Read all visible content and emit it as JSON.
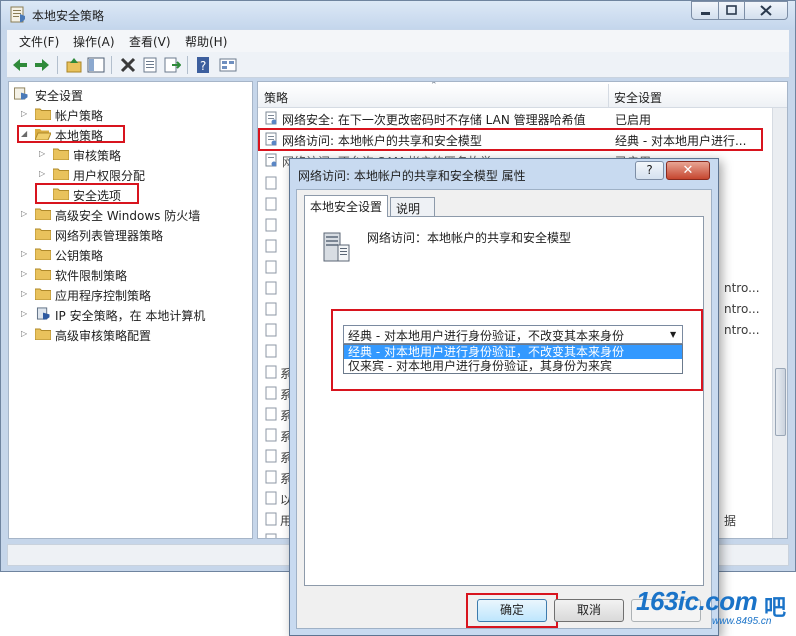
{
  "window": {
    "title": "本地安全策略"
  },
  "menu": [
    "文件(F)",
    "操作(A)",
    "查看(V)",
    "帮助(H)"
  ],
  "tree": {
    "root": "安全设置",
    "items": [
      {
        "label": "帐户策略"
      },
      {
        "label": "本地策略"
      },
      {
        "label": "审核策略"
      },
      {
        "label": "用户权限分配"
      },
      {
        "label": "安全选项"
      },
      {
        "label": "高级安全 Windows 防火墙"
      },
      {
        "label": "网络列表管理器策略"
      },
      {
        "label": "公钥策略"
      },
      {
        "label": "软件限制策略"
      },
      {
        "label": "应用程序控制策略"
      },
      {
        "label": "IP 安全策略，在 本地计算机"
      },
      {
        "label": "高级审核策略配置"
      }
    ]
  },
  "list": {
    "columns": [
      "策略",
      "安全设置"
    ],
    "rows": [
      {
        "policy": "网络安全: 在下一次更改密码时不存储 LAN 管理器哈希值",
        "setting": "已启用"
      },
      {
        "policy": "网络访问: 本地帐户的共享和安全模型",
        "setting": "经典 - 对本地用户进行..."
      },
      {
        "policy": "网络访问: 不允许 SAM 帐户的匿名枚举",
        "setting": "已启用"
      }
    ],
    "partial_right": [
      "ntro...",
      "ntro...",
      "ntro..."
    ],
    "partial_left": [
      "系",
      "系",
      "系",
      "系",
      "系",
      "系",
      "以",
      "用",
      "用"
    ],
    "partial_bottom_right": "据"
  },
  "dialog": {
    "title": "网络访问: 本地帐户的共享和安全模型 属性",
    "help_label": "?",
    "close_label": "✕",
    "tabs": [
      "本地安全设置",
      "说明"
    ],
    "policy_name": "网络访问：本地帐户的共享和安全模型",
    "combo_value": "经典 - 对本地用户进行身份验证，不改变其本来身份",
    "options": [
      "经典 - 对本地用户进行身份验证，不改变其本来身份",
      "仅来宾 - 对本地用户进行身份验证，其身份为来宾"
    ],
    "ok_label": "确定",
    "cancel_label": "取消"
  },
  "watermark": {
    "text": "163ic.com",
    "suffix": "吧",
    "url": "www.8495.cn"
  },
  "colors": {
    "highlight_red": "#d8141e",
    "selection_blue": "#3399ff"
  }
}
